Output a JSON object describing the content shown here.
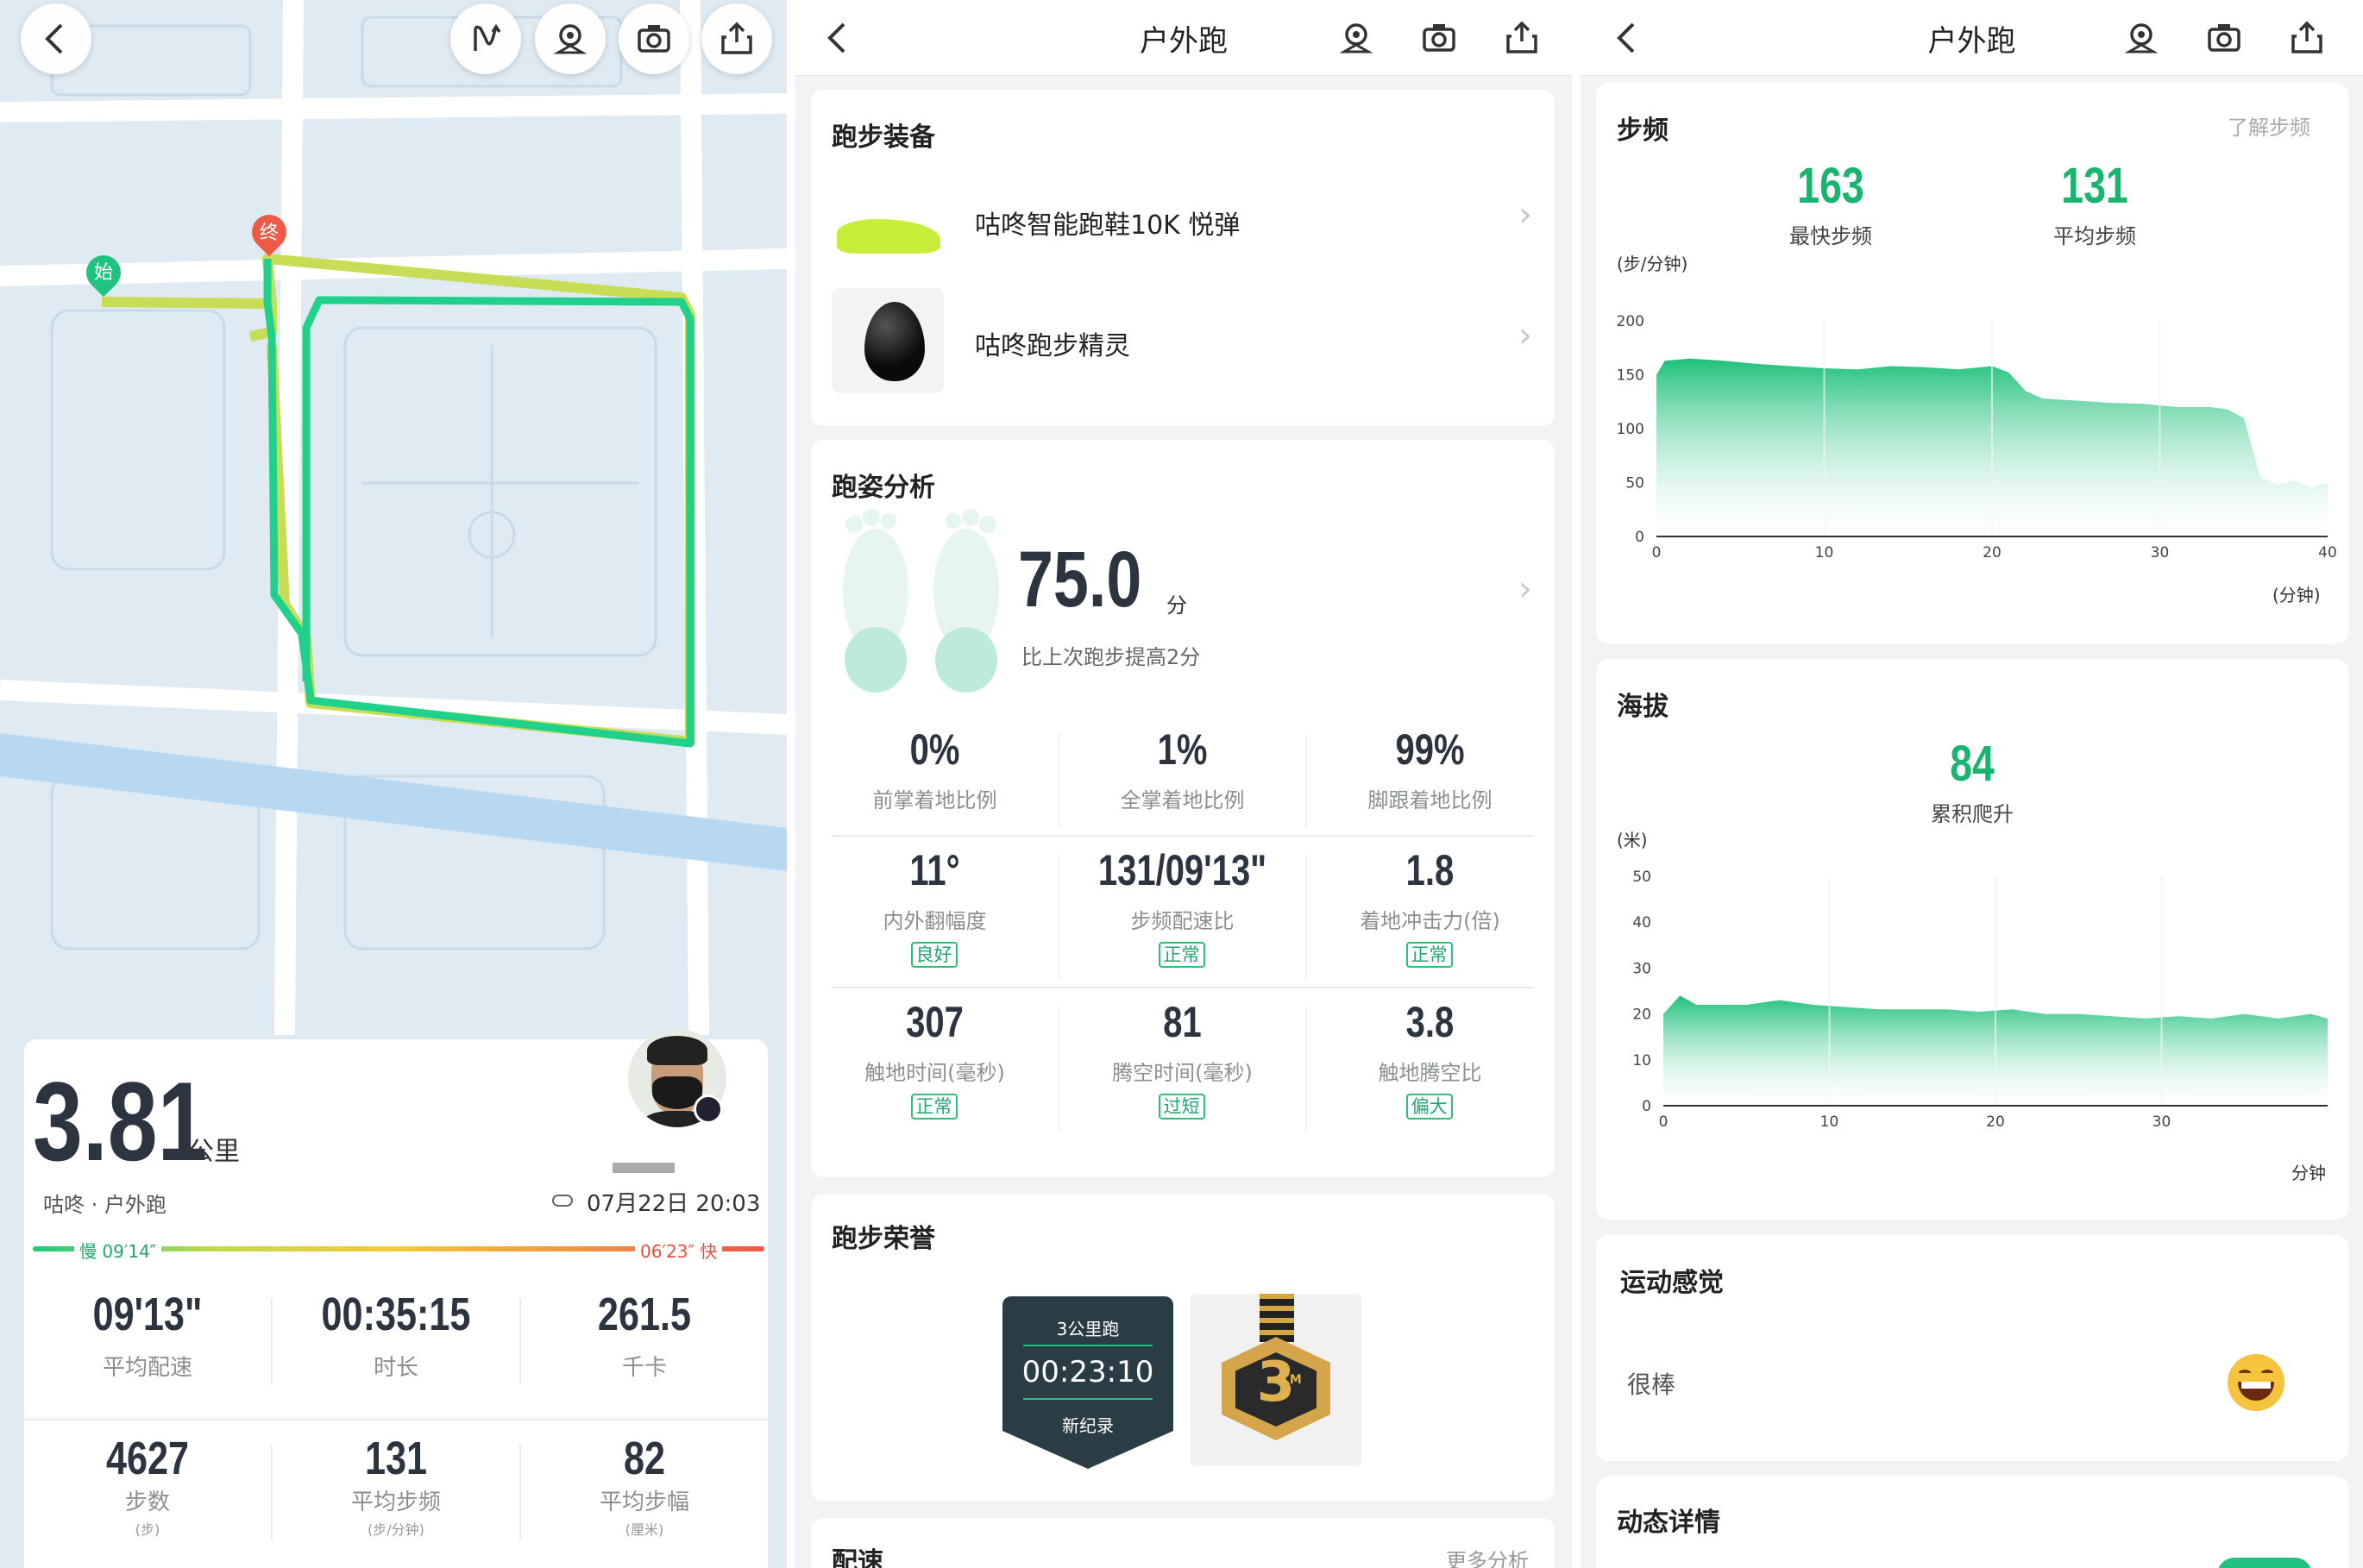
{
  "map_panel": {
    "marker_start": "始",
    "marker_end": "终",
    "distance_value": "3.81",
    "distance_unit": "公里",
    "source": "咕咚 · 户外跑",
    "datetime": "07月22日 20:03",
    "pace_slow_label": "慢 09′14″",
    "pace_fast_label": "06′23″ 快",
    "stats_row1": [
      {
        "value": "09'13\"",
        "label": "平均配速"
      },
      {
        "value": "00:35:15",
        "label": "时长"
      },
      {
        "value": "261.5",
        "label": "千卡"
      }
    ],
    "stats_row2": [
      {
        "value": "4627",
        "label": "步数",
        "unit": "(步)"
      },
      {
        "value": "131",
        "label": "平均步频",
        "unit": "(步/分钟)"
      },
      {
        "value": "82",
        "label": "平均步幅",
        "unit": "(厘米)"
      }
    ],
    "colors": {
      "route": "#1fd18a",
      "slow": "#1ec97d",
      "fast": "#f0564a",
      "start_marker": "#1fc27f",
      "end_marker": "#ee5a45"
    }
  },
  "middle_panel": {
    "title": "户外跑",
    "equipment": {
      "title": "跑步装备",
      "items": [
        {
          "name": "咕咚智能跑鞋10K 悦弹"
        },
        {
          "name": "咕咚跑步精灵"
        }
      ]
    },
    "gait": {
      "title": "跑姿分析",
      "score": "75.0",
      "score_unit": "分",
      "score_note": "比上次跑步提高2分",
      "metrics": [
        {
          "value": "0%",
          "label": "前掌着地比例",
          "badge": ""
        },
        {
          "value": "1%",
          "label": "全掌着地比例",
          "badge": ""
        },
        {
          "value": "99%",
          "label": "脚跟着地比例",
          "badge": ""
        },
        {
          "value": "11°",
          "label": "内外翻幅度",
          "badge": "良好"
        },
        {
          "value": "131/09'13\"",
          "label": "步频配速比",
          "badge": "正常"
        },
        {
          "value": "1.8",
          "label": "着地冲击力(倍)",
          "badge": "正常"
        },
        {
          "value": "307",
          "label": "触地时间(毫秒)",
          "badge": "正常"
        },
        {
          "value": "81",
          "label": "腾空时间(毫秒)",
          "badge": "过短"
        },
        {
          "value": "3.8",
          "label": "触地腾空比",
          "badge": "偏大"
        }
      ]
    },
    "honor": {
      "title": "跑步荣誉",
      "badge_top": "3公里跑",
      "badge_time": "00:23:10",
      "badge_bottom": "新纪录",
      "medal_text": "3",
      "medal_sub": "KM"
    },
    "pace": {
      "title": "配速",
      "more": "更多分析"
    }
  },
  "right_panel": {
    "title": "户外跑",
    "cadence": {
      "title": "步频",
      "link": "了解步频",
      "max_value": "163",
      "max_label": "最快步频",
      "avg_value": "131",
      "avg_label": "平均步频",
      "yunit": "(步/分钟)",
      "xunit": "(分钟)"
    },
    "altitude": {
      "title": "海拔",
      "climb_value": "84",
      "climb_label": "累积爬升",
      "yunit": "(米)",
      "xunit": "分钟"
    },
    "feeling": {
      "title": "运动感觉",
      "value": "很棒"
    },
    "dynamic": {
      "title": "动态详情"
    }
  },
  "chart_data": [
    {
      "type": "area",
      "title": "步频",
      "ylabel": "(步/分钟)",
      "xlabel": "(分钟)",
      "ylim": [
        0,
        200
      ],
      "xlim": [
        0,
        40
      ],
      "yticks": [
        "0",
        "50",
        "100",
        "150",
        "200"
      ],
      "xticks": [
        "0",
        "10",
        "20",
        "30",
        "40"
      ],
      "x": [
        0,
        0.5,
        2,
        4,
        6,
        8,
        10,
        12,
        14,
        16,
        18,
        20,
        21,
        22,
        23,
        25,
        27,
        29,
        31,
        33,
        34,
        35,
        36,
        37,
        38,
        39,
        40
      ],
      "y": [
        150,
        163,
        165,
        163,
        160,
        158,
        156,
        155,
        158,
        157,
        155,
        158,
        152,
        135,
        128,
        126,
        124,
        123,
        120,
        120,
        118,
        110,
        55,
        48,
        52,
        45,
        50
      ]
    },
    {
      "type": "area",
      "title": "海拔",
      "ylabel": "(米)",
      "xlabel": "分钟",
      "ylim": [
        0,
        50
      ],
      "xlim": [
        0,
        40
      ],
      "yticks": [
        "0",
        "10",
        "20",
        "30",
        "40",
        "50"
      ],
      "xticks": [
        "0",
        "10",
        "20",
        "30"
      ],
      "x": [
        0,
        1,
        2,
        3,
        5,
        7,
        9,
        11,
        13,
        15,
        17,
        19,
        21,
        23,
        25,
        27,
        29,
        31,
        33,
        35,
        37,
        39,
        40
      ],
      "y": [
        20,
        24,
        22,
        22,
        22,
        23,
        22,
        21.5,
        21,
        21,
        21,
        20.5,
        21,
        20,
        20,
        19.5,
        19,
        19.5,
        19,
        20,
        19,
        20,
        19
      ]
    }
  ]
}
